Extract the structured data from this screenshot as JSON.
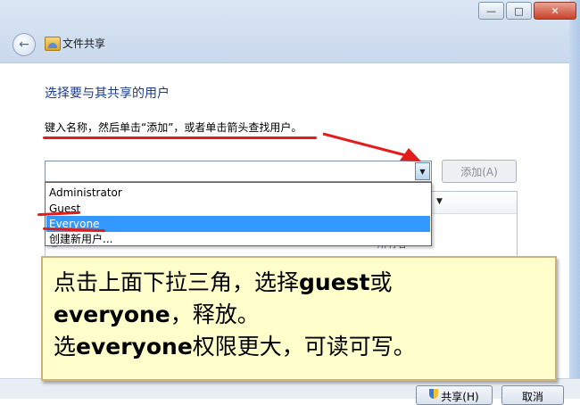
{
  "window": {
    "title": "文件共享",
    "minimize": "—",
    "maximize": "□",
    "close": "✕"
  },
  "page": {
    "heading": "选择要与其共享的用户",
    "instruction": "键入名称，然后单击“添加”，或者单击箭头查找用户。"
  },
  "name_combo": {
    "value": "",
    "placeholder": ""
  },
  "add_button": "添加(A)",
  "dropdown": {
    "items": [
      "Administrator",
      "Guest",
      "Everyone",
      "创建新用户..."
    ],
    "selected": "Everyone"
  },
  "user_list": {
    "row_perm": "所有者"
  },
  "note": {
    "line1_pre": "点击上面下拉三角，选择",
    "line1_bold": "guest",
    "line1_post": "或",
    "line2_bold": "everyone",
    "line2_post": "，释放。",
    "line3_pre": "选",
    "line3_bold": "everyone",
    "line3_post": "权限更大，可读可写。"
  },
  "footer": {
    "share_label": "共享(H)",
    "cancel_label": "取消"
  },
  "colors": {
    "highlight": "#3399ff",
    "annotation_red": "#e31c1c",
    "note_bg": "#ffffcc",
    "heading": "#1e3b8c"
  },
  "icons": {
    "back": "back-arrow-icon",
    "app": "file-share-icon",
    "dropdown": "chevron-down-icon",
    "shield": "shield-icon"
  }
}
